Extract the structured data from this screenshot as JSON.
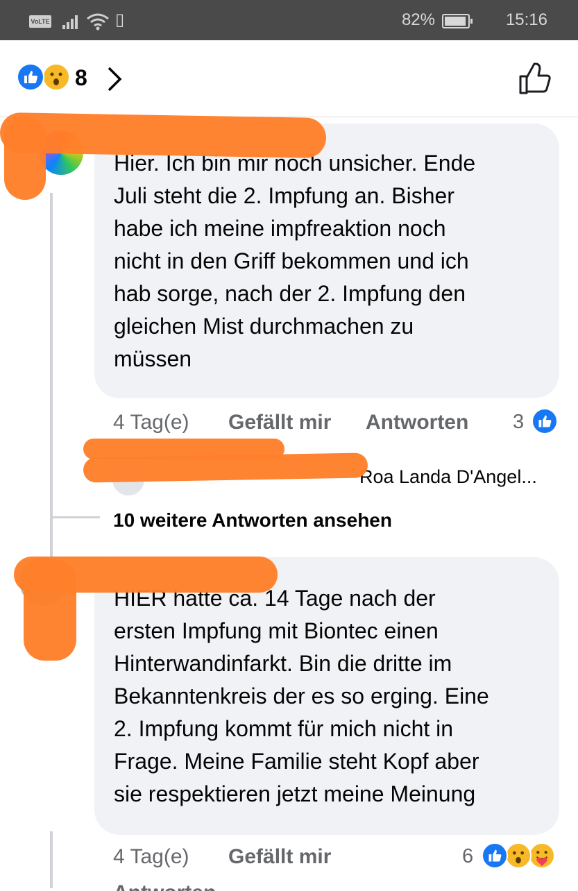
{
  "status_bar": {
    "volte": "VoLTE",
    "battery": "82%",
    "time": "15:16",
    "battery_level": 0.82
  },
  "reactions_header": {
    "count": "8",
    "icons": [
      "like-icon",
      "wow-icon"
    ]
  },
  "comments": [
    {
      "author": "",
      "lines": [
        "Hier. Ich bin mir noch unsicher. Ende",
        "Juli steht die 2. Impfung an. Bisher",
        "habe ich meine impfreaktion noch",
        "nicht in den Griff bekommen und ich",
        "hab sorge, nach der 2. Impfung den",
        "gleichen Mist durchmachen zu",
        "müssen"
      ],
      "time": "4 Tag(e)",
      "like_label": "Gefällt mir",
      "reply_label": "Antworten",
      "reaction_count": "3",
      "reaction_icons": [
        "like-icon"
      ],
      "reply_preview": "Roa Landa D'Angel...",
      "more_replies": "10 weitere Antworten ansehen"
    },
    {
      "author": "",
      "lines": [
        "HIER  hatte ca. 14 Tage nach der",
        "ersten Impfung mit Biontec einen",
        "Hinterwandinfarkt.  Bin die dritte im",
        "Bekanntenkreis der es so erging. Eine",
        "2. Impfung kommt für mich nicht in",
        "Frage.  Meine Familie steht Kopf aber",
        "sie respektieren jetzt meine Meinung"
      ],
      "time": "4 Tag(e)",
      "like_label": "Gefällt mir",
      "reply_label": "Antworten",
      "reaction_count": "6",
      "reaction_icons": [
        "like-icon",
        "wow-icon",
        "care-icon"
      ]
    }
  ]
}
